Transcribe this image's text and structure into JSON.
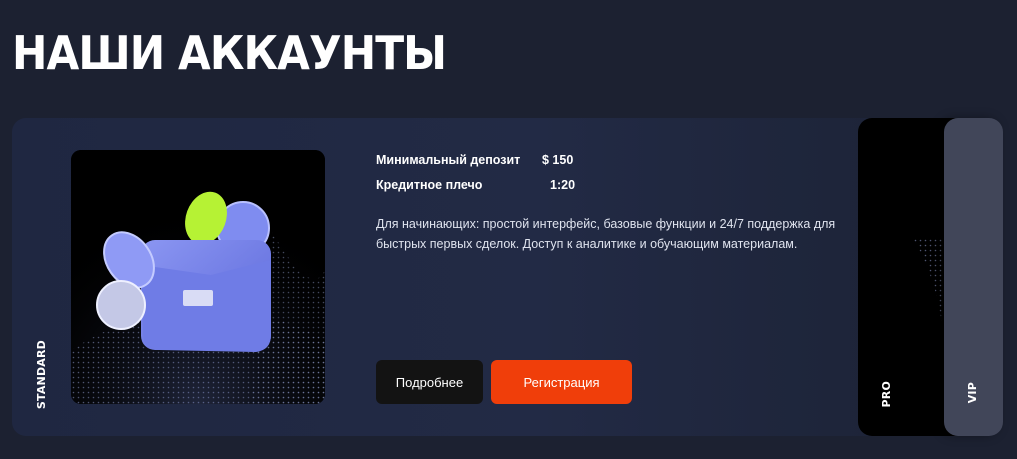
{
  "page": {
    "title": "НАШИ АККАУНТЫ"
  },
  "colors": {
    "background": "#1c2131",
    "card": "#222a45",
    "accent": "#f03e0a",
    "dark_button": "#131313",
    "vip_card": "#414659"
  },
  "accounts": [
    {
      "tier": "STANDARD",
      "image_icon": "wallet-with-coins-icon",
      "specs": [
        {
          "label": "Минимальный депозит",
          "value": "$ 150"
        },
        {
          "label": "Кредитное плечо",
          "value": "1:20"
        }
      ],
      "description": "Для начинающих: простой интерфейс, базовые функции и 24/7 поддержка для быстрых первых сделок. Доступ к аналитике и обучающим материалам.",
      "buttons": {
        "more": "Подробнее",
        "register": "Регистрация"
      }
    },
    {
      "tier": "PRO"
    },
    {
      "tier": "VIP"
    }
  ]
}
